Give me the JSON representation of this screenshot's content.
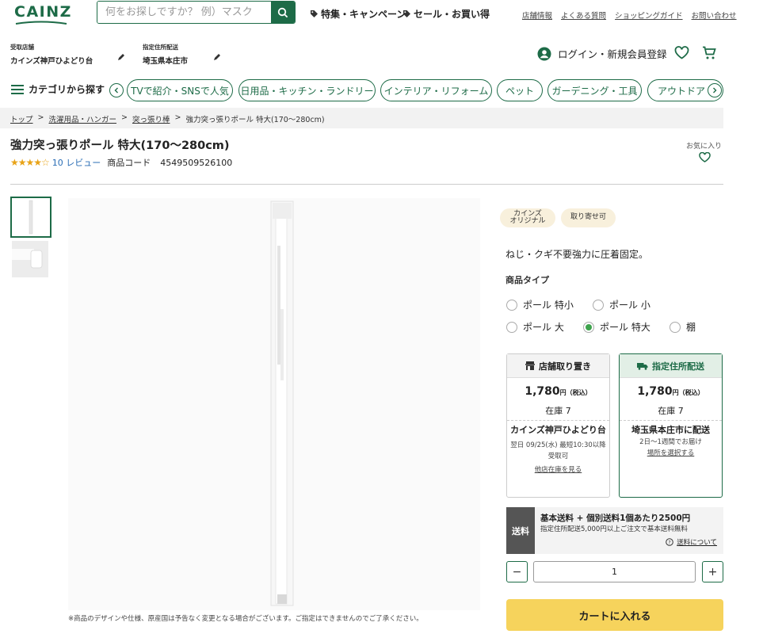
{
  "header": {
    "logo": "CAINZ",
    "search_placeholder": "何をお探しですか？ 例）マスク",
    "promo_features": "特集・キャンペーン",
    "promo_sale": "セール・お買い得",
    "top_links": [
      "店舗情報",
      "よくある質問",
      "ショッピングガイド",
      "お問い合わせ"
    ],
    "pickup_store_label": "受取店舗",
    "pickup_store_value": "カインズ神戸ひよどり台",
    "delivery_label": "指定住所配送",
    "delivery_value": "埼玉県本庄市",
    "login": "ログイン・新規会員登録"
  },
  "categories": {
    "menu_label": "カテゴリから探す",
    "chips": [
      "TVで紹介・SNSで人気",
      "日用品・キッチン・ランドリー",
      "インテリア・リフォーム",
      "ペット",
      "ガーデニング・工具",
      "アウトドア・"
    ]
  },
  "breadcrumb": [
    "トップ",
    "洗濯用品・ハンガー",
    "突っ張り棒",
    "強力突っ張りポール 特大(170～280cm)"
  ],
  "product": {
    "title": "強力突っ張りポール 特大(170～280cm)",
    "stars": "★★★★☆",
    "rating": 4,
    "reviews": "10 レビュー",
    "code_label": "商品コード",
    "code": "4549509526100",
    "favorite_label": "お気に入り",
    "tags": [
      "カインズ\nオリジナル",
      "取り寄せ可"
    ],
    "description": "ねじ・クギ不要強力に圧着固定。",
    "type_label": "商品タイプ",
    "types": [
      "ポール 特小",
      "ポール 小",
      "ポール 大",
      "ポール 特大",
      "棚"
    ],
    "selected_type": "ポール 特大",
    "image_note": "※商品のデザインや仕様、原産国は予告なく変更となる場合がございます。ご指定はできませんのでご了承ください。"
  },
  "store_card": {
    "title": "店舗取り置き",
    "price": "1,780",
    "yen": "円",
    "tax": "（税込）",
    "stock": "在庫  7",
    "store": "カインズ神戸ひよどり台",
    "pickup": "翌日 09/25(水) 最短10:30以降受取可",
    "link": "他店在庫を見る"
  },
  "delivery_card": {
    "title": "指定住所配送",
    "price": "1,780",
    "yen": "円",
    "tax": "（税込）",
    "stock": "在庫  7",
    "dest": "埼玉県本庄市に配送",
    "eta": "2日～1週間でお届け",
    "link": "場所を選択する"
  },
  "shipping": {
    "label": "送料",
    "line1": "基本送料 + 個別送料1個あたり2500円",
    "line2": "指定住所配送5,000円以上ご注文で基本送料無料",
    "link": "送料について"
  },
  "quantity": {
    "minus": "−",
    "value": "1",
    "plus": "+"
  },
  "cart_button": "カートに入れる",
  "colors": {
    "brand": "#1d6b47",
    "cart": "#f6d35c",
    "star": "#e8a317"
  }
}
